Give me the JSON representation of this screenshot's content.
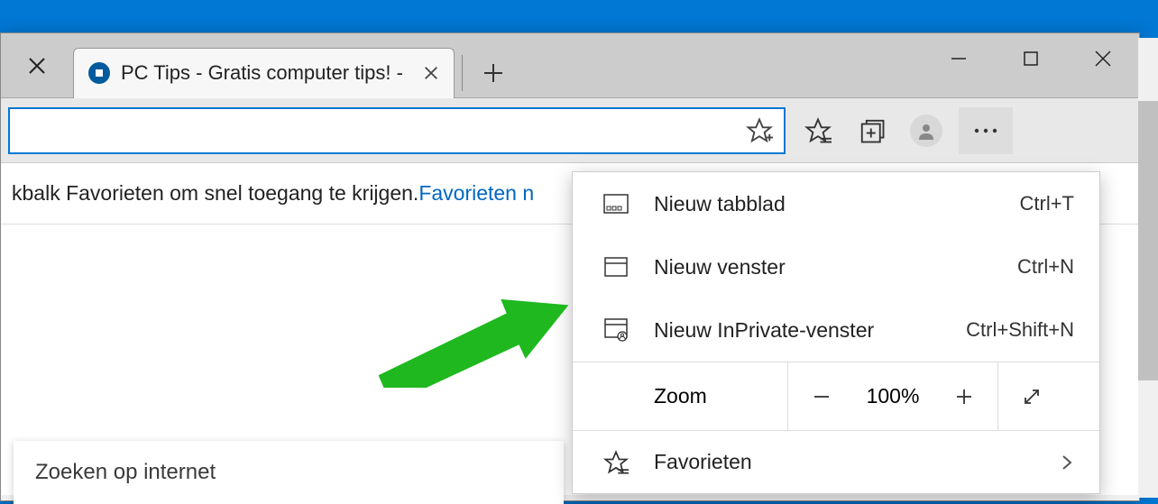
{
  "tab": {
    "title": "PC Tips - Gratis computer tips! -"
  },
  "favorites_hint": {
    "prefix": "kbalk Favorieten om snel toegang te krijgen. ",
    "link": "Favorieten n"
  },
  "search": {
    "placeholder": "Zoeken op internet"
  },
  "menu": {
    "new_tab": {
      "label": "Nieuw tabblad",
      "shortcut": "Ctrl+T"
    },
    "new_window": {
      "label": "Nieuw venster",
      "shortcut": "Ctrl+N"
    },
    "new_inprivate": {
      "label": "Nieuw InPrivate-venster",
      "shortcut": "Ctrl+Shift+N"
    },
    "zoom": {
      "label": "Zoom",
      "value": "100%"
    },
    "favorites": {
      "label": "Favorieten"
    }
  }
}
